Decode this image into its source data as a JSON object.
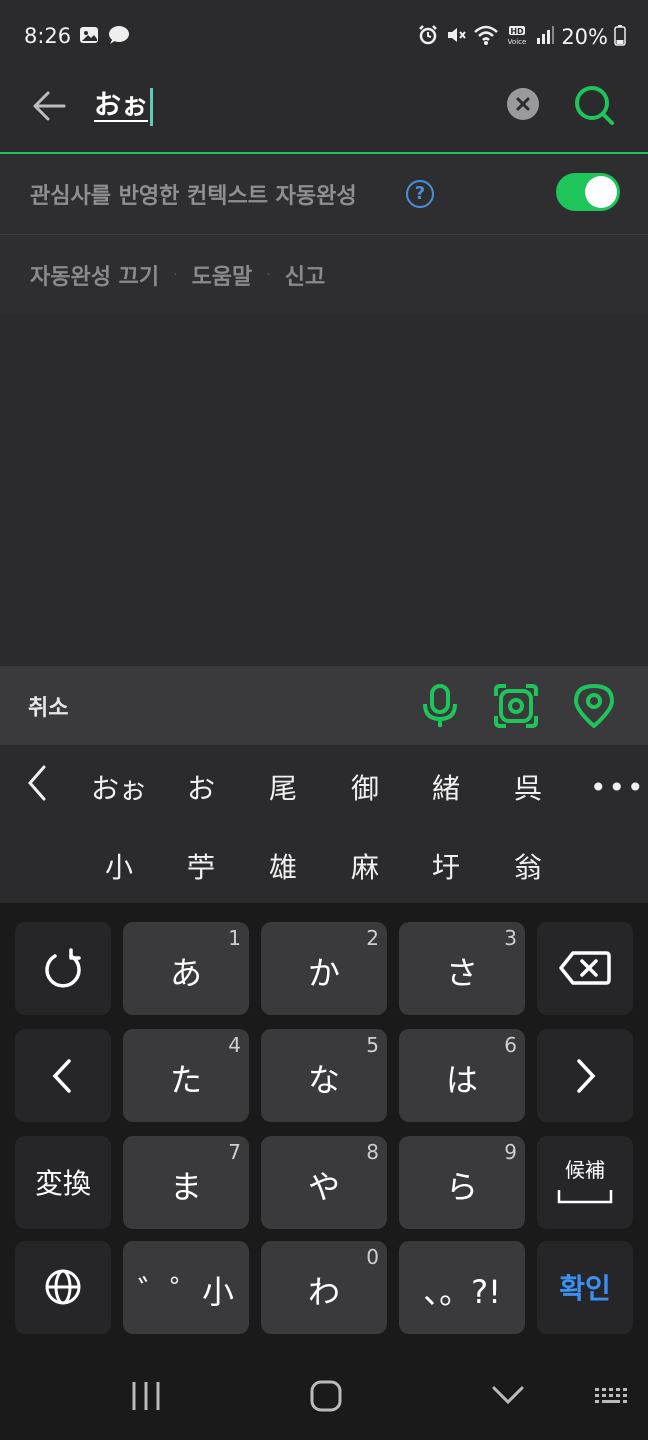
{
  "status_bar": {
    "time": "8:26",
    "battery": "20%",
    "icons": [
      "image-icon",
      "chat-bubble-icon",
      "alarm-icon",
      "mute-icon",
      "wifi-icon",
      "hd-voice-icon",
      "signal-icon",
      "battery-icon"
    ]
  },
  "search": {
    "query": "おぉ",
    "icons": [
      "back-arrow-icon",
      "clear-icon",
      "search-icon"
    ]
  },
  "autocomplete": {
    "label": "관심사를 반영한 컨텍스트 자동완성",
    "help": "?",
    "enabled": true,
    "toggle_color": "#1ec55a"
  },
  "links": {
    "off": "자동완성 끄기",
    "sep1": "·",
    "help": "도움말",
    "sep2": "·",
    "report": "신고"
  },
  "action_bar": {
    "cancel": "취소",
    "icons": [
      "microphone-icon",
      "camera-lens-icon",
      "location-pin-icon"
    ]
  },
  "candidates": {
    "row1": [
      "おぉ",
      "お",
      "尾",
      "御",
      "緒",
      "呉"
    ],
    "row2": [
      "小",
      "苧",
      "雄",
      "麻",
      "圩",
      "翁"
    ],
    "more": "•••"
  },
  "keyboard": {
    "row1": [
      {
        "main": "",
        "num": ""
      },
      {
        "main": "あ",
        "num": "1"
      },
      {
        "main": "か",
        "num": "2"
      },
      {
        "main": "さ",
        "num": "3"
      },
      {
        "main": "",
        "num": ""
      }
    ],
    "row2": [
      {
        "main": "",
        "num": ""
      },
      {
        "main": "た",
        "num": "4"
      },
      {
        "main": "な",
        "num": "5"
      },
      {
        "main": "は",
        "num": "6"
      },
      {
        "main": "",
        "num": ""
      }
    ],
    "row3": [
      {
        "main": "変換",
        "num": ""
      },
      {
        "main": "ま",
        "num": "7"
      },
      {
        "main": "や",
        "num": "8"
      },
      {
        "main": "ら",
        "num": "9"
      },
      {
        "main": "候補",
        "num": ""
      }
    ],
    "row4": [
      {
        "main": "",
        "num": ""
      },
      {
        "main": "゛゜小",
        "num": ""
      },
      {
        "main": "わ",
        "num": "0"
      },
      {
        "main": "、。?!",
        "num": ""
      },
      {
        "main": "확인",
        "num": ""
      }
    ]
  },
  "colors": {
    "accent_green": "#1ec55a",
    "confirm_blue": "#3d8ff3",
    "background": "#2b2b2d"
  }
}
